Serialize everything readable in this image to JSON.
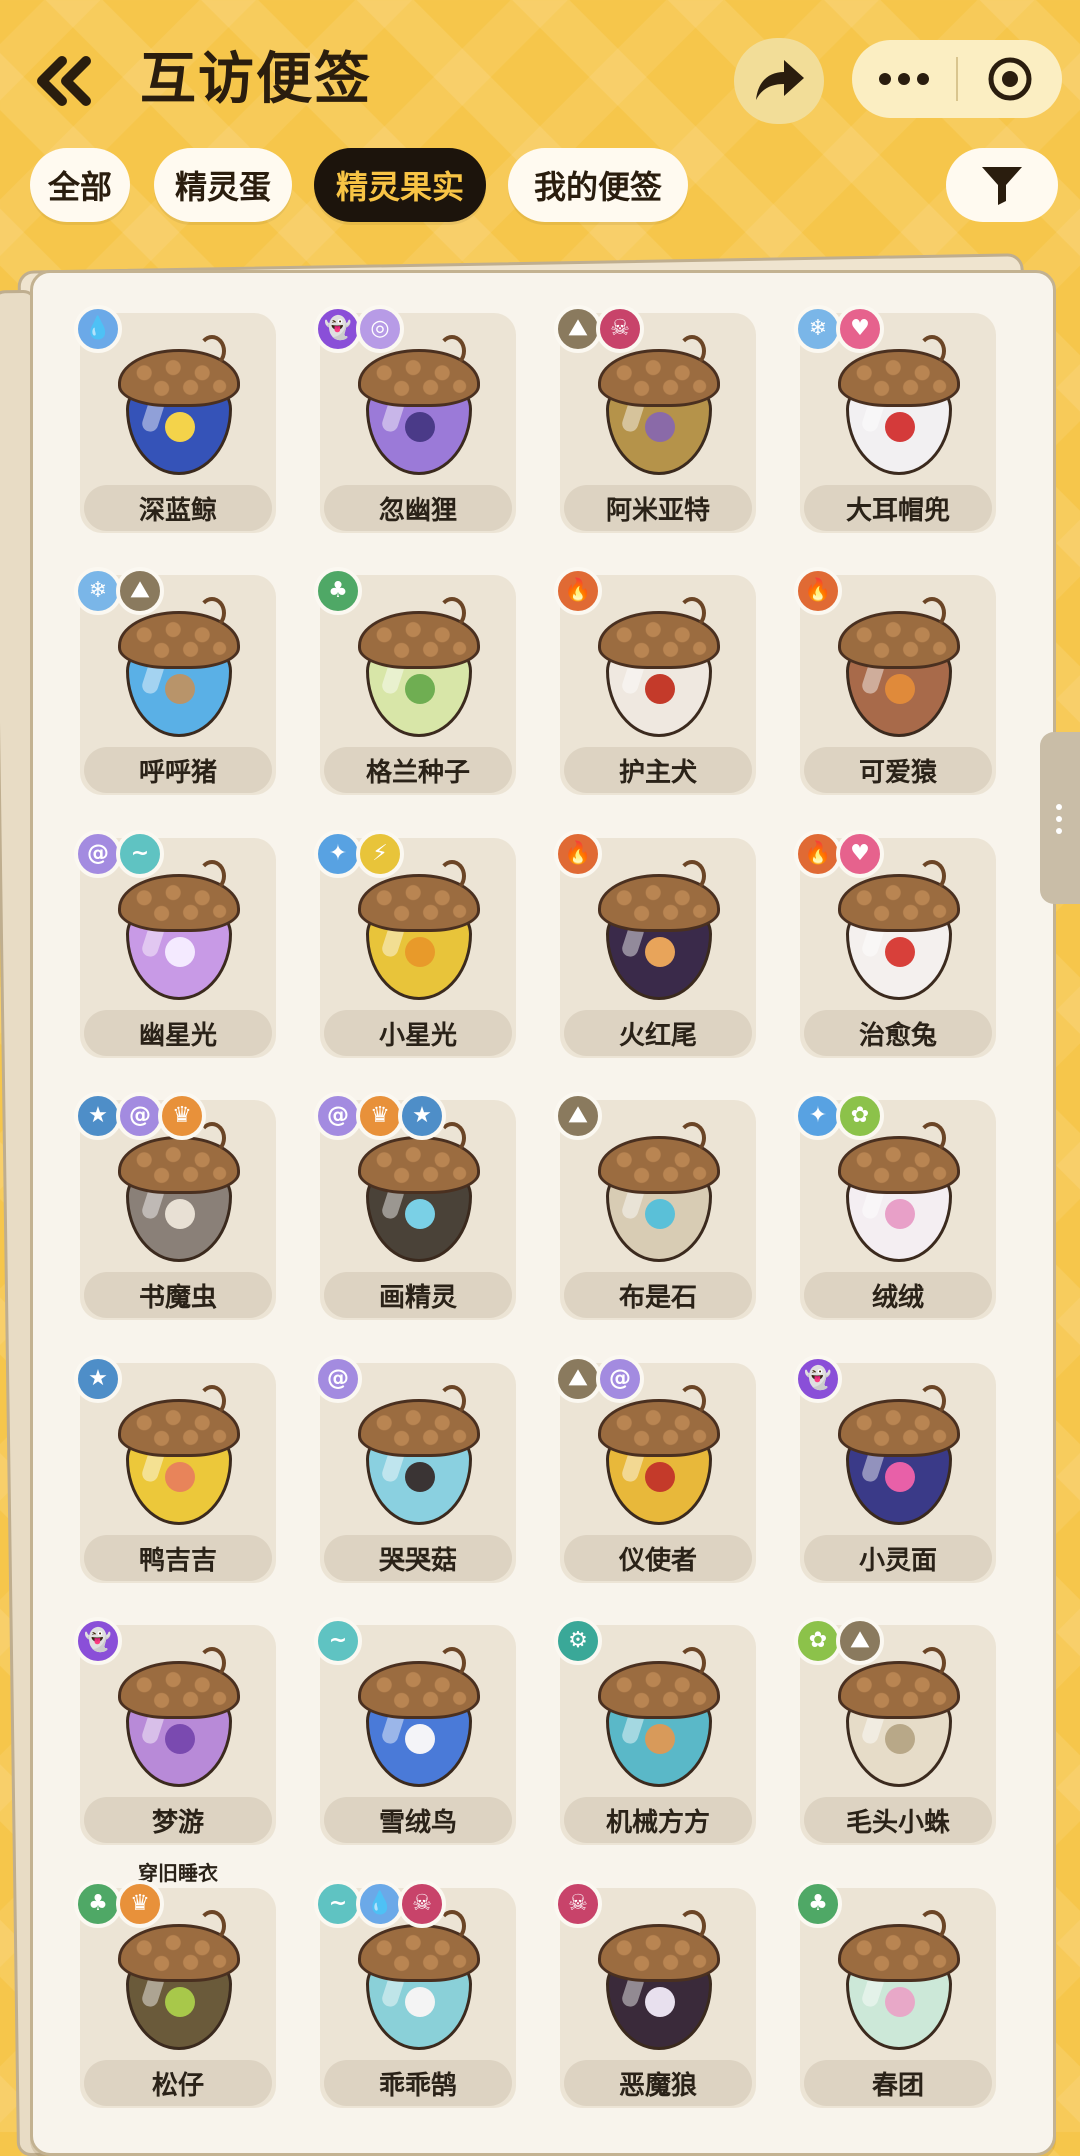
{
  "header": {
    "title": "互访便签"
  },
  "tabs": [
    {
      "label": "全部",
      "active": false
    },
    {
      "label": "精灵蛋",
      "active": false
    },
    {
      "label": "精灵果实",
      "active": true
    },
    {
      "label": "我的便签",
      "active": false
    }
  ],
  "icons": {
    "back": "double-chevron-left-icon",
    "share": "share-arrow-icon",
    "more": "more-dots-icon",
    "close": "target-circle-icon",
    "filter": "funnel-icon"
  },
  "colors": {
    "background": "#f6c64b",
    "active_tab_bg": "#1c140c",
    "active_tab_text": "#f8c445",
    "paper": "#f8f4ec"
  },
  "elements": {
    "water": {
      "color": "#6ba9e8",
      "glyph": "💧"
    },
    "ghost": {
      "color": "#8a4fd8",
      "glyph": "👻"
    },
    "mind": {
      "color": "#b79be6",
      "glyph": "◎"
    },
    "ground": {
      "color": "#8a7a5e",
      "glyph": "⛰"
    },
    "demon": {
      "color": "#c8436a",
      "glyph": "☠"
    },
    "ice": {
      "color": "#7ab6e8",
      "glyph": "❄"
    },
    "cute": {
      "color": "#e6628d",
      "glyph": "♥"
    },
    "grass": {
      "color": "#4fa866",
      "glyph": "♣"
    },
    "fire": {
      "color": "#e06a34",
      "glyph": "🔥"
    },
    "vortex": {
      "color": "#a38be0",
      "glyph": "@"
    },
    "wing": {
      "color": "#5fc3c2",
      "glyph": "~"
    },
    "light": {
      "color": "#58a2e2",
      "glyph": "✦"
    },
    "electric": {
      "color": "#e8c43a",
      "glyph": "⚡"
    },
    "normal": {
      "color": "#4e8ec8",
      "glyph": "★"
    },
    "warrior": {
      "color": "#e8913a",
      "glyph": "♛"
    },
    "machine": {
      "color": "#3aa898",
      "glyph": "⚙"
    },
    "bug": {
      "color": "#8cc24a",
      "glyph": "✿"
    }
  },
  "fruits": [
    {
      "name": "深蓝鲸",
      "badges": [
        "water"
      ],
      "body": "#3553b8",
      "deco": "#f4d34a"
    },
    {
      "name": "忽幽狸",
      "badges": [
        "ghost",
        "mind"
      ],
      "body": "#9b7ad8",
      "deco": "#4a3a88"
    },
    {
      "name": "阿米亚特",
      "badges": [
        "ground",
        "demon"
      ],
      "body": "#b5934a",
      "deco": "#8a6aa8"
    },
    {
      "name": "大耳帽兜",
      "badges": [
        "ice",
        "cute"
      ],
      "body": "#f2f0f2",
      "deco": "#d43a3a"
    },
    {
      "name": "呼呼猪",
      "badges": [
        "ice",
        "ground"
      ],
      "body": "#5ab0e6",
      "deco": "#b8946a"
    },
    {
      "name": "格兰种子",
      "badges": [
        "grass"
      ],
      "body": "#d8e6a8",
      "deco": "#6fae52"
    },
    {
      "name": "护主犬",
      "badges": [
        "fire"
      ],
      "body": "#efe8e0",
      "deco": "#c43a2a"
    },
    {
      "name": "可爱猿",
      "badges": [
        "fire"
      ],
      "body": "#a86a4a",
      "deco": "#e08a3a"
    },
    {
      "name": "幽星光",
      "badges": [
        "vortex",
        "wing"
      ],
      "body": "#c89ae6",
      "deco": "#f4eaff"
    },
    {
      "name": "小星光",
      "badges": [
        "light",
        "electric"
      ],
      "body": "#e8c43a",
      "deco": "#e89a2a"
    },
    {
      "name": "火红尾",
      "badges": [
        "fire"
      ],
      "body": "#3a2a4a",
      "deco": "#e8a45a"
    },
    {
      "name": "治愈兔",
      "badges": [
        "fire",
        "cute"
      ],
      "body": "#f4f0ee",
      "deco": "#d8403a"
    },
    {
      "name": "书魔虫",
      "badges": [
        "normal",
        "vortex",
        "warrior"
      ],
      "body": "#8a8078",
      "deco": "#e8e0d4"
    },
    {
      "name": "画精灵",
      "badges": [
        "vortex",
        "warrior",
        "normal"
      ],
      "body": "#4a4238",
      "deco": "#7ad0e6"
    },
    {
      "name": "布是石",
      "badges": [
        "ground"
      ],
      "body": "#d8ccb4",
      "deco": "#5ac0d8"
    },
    {
      "name": "绒绒",
      "badges": [
        "light",
        "bug"
      ],
      "body": "#f4eef2",
      "deco": "#e8a0c8"
    },
    {
      "name": "鸭吉吉",
      "badges": [
        "normal"
      ],
      "body": "#ecc83a",
      "deco": "#e8845a"
    },
    {
      "name": "哭哭菇",
      "badges": [
        "vortex"
      ],
      "body": "#8ad0e0",
      "deco": "#3a3434"
    },
    {
      "name": "仪使者",
      "badges": [
        "ground",
        "vortex"
      ],
      "body": "#e8b83a",
      "deco": "#c43a2a"
    },
    {
      "name": "小灵面",
      "badges": [
        "ghost"
      ],
      "body": "#3a3a88",
      "deco": "#e860a8"
    },
    {
      "name": "梦游",
      "badges": [
        "ghost"
      ],
      "body": "#b88ad8",
      "deco": "#7a4ab0",
      "sub": "穿旧睡衣"
    },
    {
      "name": "雪绒鸟",
      "badges": [
        "wing"
      ],
      "body": "#4a7ad8",
      "deco": "#f4f4f8"
    },
    {
      "name": "机械方方",
      "badges": [
        "machine"
      ],
      "body": "#5ab8c8",
      "deco": "#d89a5a"
    },
    {
      "name": "毛头小蛛",
      "badges": [
        "bug",
        "ground"
      ],
      "body": "#e6dcc8",
      "deco": "#b8a888"
    },
    {
      "name": "松仔",
      "badges": [
        "grass",
        "warrior"
      ],
      "body": "#6a5a3a",
      "deco": "#a8c84a"
    },
    {
      "name": "乖乖鹄",
      "badges": [
        "wing",
        "water",
        "demon"
      ],
      "body": "#8ad0d8",
      "deco": "#f4f4f4"
    },
    {
      "name": "恶魔狼",
      "badges": [
        "demon"
      ],
      "body": "#3a2a3a",
      "deco": "#e8e0ee"
    },
    {
      "name": "春团",
      "badges": [
        "grass"
      ],
      "body": "#cce8d8",
      "deco": "#e8a8c8"
    }
  ]
}
